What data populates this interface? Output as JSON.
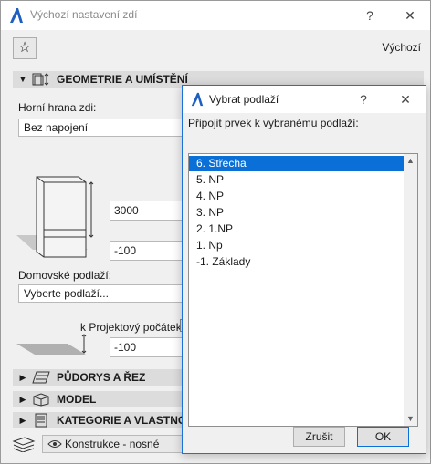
{
  "window": {
    "title": "Výchozí nastavení zdí",
    "help_label": "?",
    "close_label": "✕"
  },
  "toolbar": {
    "defaults_label": "Výchozí"
  },
  "geometry": {
    "header": "GEOMETRIE A UMÍSTĚNÍ",
    "top_edge_label": "Horní hrana zdi:",
    "top_edge_value": "Bez napojení",
    "height_value": "3000",
    "offset_value": "-100",
    "home_story_label": "Domovské podlaží:",
    "home_story_value": "Vyberte podlaží...",
    "project_zero_label": "k Projektový počátek",
    "project_offset_value": "-100"
  },
  "sections": [
    {
      "label": "PŮDORYS A ŘEZ"
    },
    {
      "label": "MODEL"
    },
    {
      "label": "KATEGORIE A VLASTNOSTI"
    }
  ],
  "bottom": {
    "layer_label": "Konstrukce - nosné"
  },
  "dialog": {
    "title": "Vybrat podlaží",
    "help_label": "?",
    "close_label": "✕",
    "prompt": "Připojit prvek k vybranému podlaží:",
    "stories": [
      "6. Střecha",
      "5. NP",
      "4. NP",
      "3. NP",
      "2. 1.NP",
      "1. Np",
      "-1. Základy"
    ],
    "selected_index": 0,
    "cancel_label": "Zrušit",
    "ok_label": "OK"
  },
  "colors": {
    "accent": "#0a6fd6",
    "dialog_border": "#1a72d8",
    "section_bg": "#dcdcdc"
  }
}
